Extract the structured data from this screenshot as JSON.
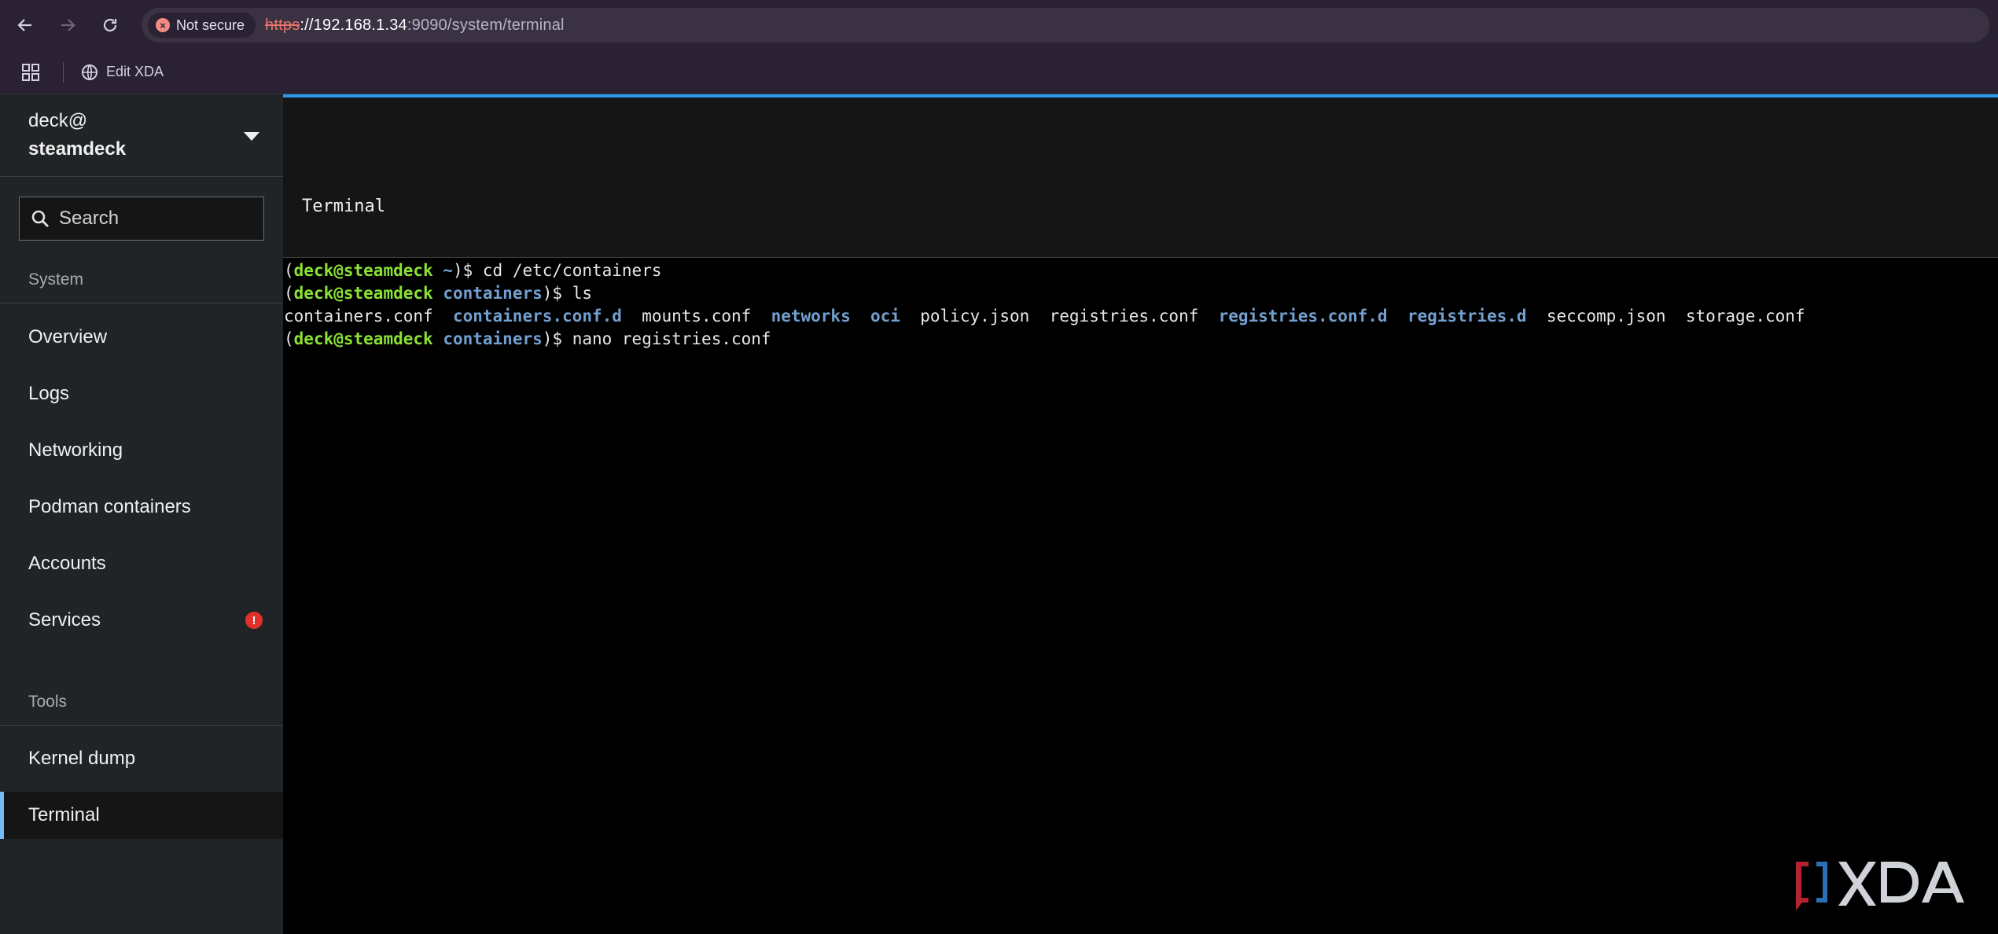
{
  "browser": {
    "security_label": "Not secure",
    "url_scheme": "https",
    "url_host": "://192.168.1.34",
    "url_path": ":9090/system/terminal",
    "bookmark_label": "Edit XDA"
  },
  "sidebar": {
    "host_user": "deck@",
    "host_name": "steamdeck",
    "search_placeholder": "Search",
    "system_label": "System",
    "system_items": [
      {
        "label": "Overview"
      },
      {
        "label": "Logs"
      },
      {
        "label": "Networking"
      },
      {
        "label": "Podman containers"
      },
      {
        "label": "Accounts"
      },
      {
        "label": "Services",
        "badge": "!"
      }
    ],
    "tools_label": "Tools",
    "tools_items": [
      {
        "label": "Kernel dump"
      },
      {
        "label": "Terminal",
        "active": true
      }
    ],
    "accent_color": "#73bcf7",
    "alert_color": "#e0302a"
  },
  "main": {
    "title": "Terminal",
    "terminal": {
      "prompt_open": "(",
      "prompt_user": "deck@steamdeck",
      "prompt_dollar": ")$ ",
      "line1_dir": " ~",
      "line1_cmd": "cd /etc/containers",
      "line2_dir": " containers",
      "line2_cmd": "ls",
      "ls_output": [
        {
          "name": "containers.conf",
          "dir": false
        },
        {
          "name": "containers.conf.d",
          "dir": true
        },
        {
          "name": "mounts.conf",
          "dir": false
        },
        {
          "name": "networks",
          "dir": true
        },
        {
          "name": "oci",
          "dir": true
        },
        {
          "name": "policy.json",
          "dir": false
        },
        {
          "name": "registries.conf",
          "dir": false
        },
        {
          "name": "registries.conf.d",
          "dir": true
        },
        {
          "name": "registries.d",
          "dir": true
        },
        {
          "name": "seccomp.json",
          "dir": false
        },
        {
          "name": "storage.conf",
          "dir": false
        }
      ],
      "line4_dir": " containers",
      "line4_cmd": "nano registries.conf"
    },
    "user_color": "#8ae234",
    "dir_color": "#729fcf"
  },
  "watermark": {
    "brand": "XDA"
  }
}
